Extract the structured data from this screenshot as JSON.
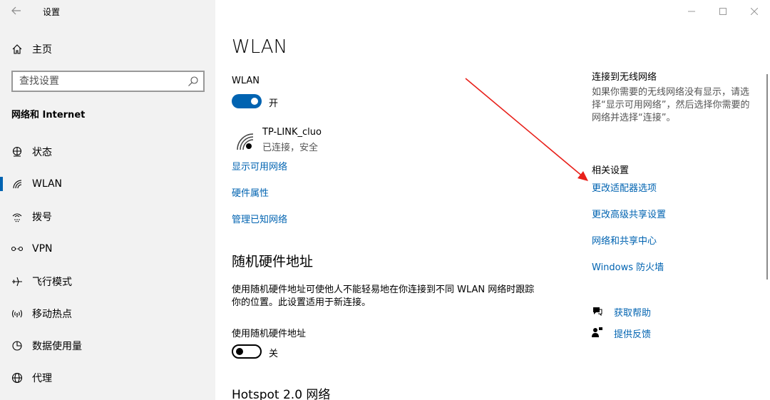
{
  "titlebar": {
    "title": "设置",
    "back_icon": "arrow-left-icon",
    "controls": [
      "minimize-icon",
      "maximize-icon",
      "close-icon"
    ]
  },
  "sidebar": {
    "home_label": "主页",
    "search_placeholder": "查找设置",
    "section": "网络和 Internet",
    "items": [
      {
        "label": "状态",
        "icon": "globe-status-icon"
      },
      {
        "label": "WLAN",
        "icon": "wifi-icon",
        "selected": true
      },
      {
        "label": "拨号",
        "icon": "dialup-icon"
      },
      {
        "label": "VPN",
        "icon": "vpn-icon"
      },
      {
        "label": "飞行模式",
        "icon": "airplane-icon"
      },
      {
        "label": "移动热点",
        "icon": "hotspot-icon"
      },
      {
        "label": "数据使用量",
        "icon": "data-usage-icon"
      },
      {
        "label": "代理",
        "icon": "globe-icon"
      }
    ]
  },
  "main": {
    "title": "WLAN",
    "wlan_label": "WLAN",
    "wlan_toggle": {
      "state": "on",
      "text": "开"
    },
    "network": {
      "name": "TP-LINK_cluo",
      "status": "已连接，安全"
    },
    "links": [
      "显示可用网络",
      "硬件属性",
      "管理已知网络"
    ],
    "random_mac": {
      "title": "随机硬件地址",
      "description": "使用随机硬件地址可使他人不能轻易地在你连接到不同 WLAN 网络时跟踪你的位置。此设置适用于新连接。",
      "toggle_label": "使用随机硬件地址",
      "toggle": {
        "state": "off",
        "text": "关"
      }
    },
    "hotspot_title": "Hotspot 2.0 网络"
  },
  "right": {
    "connect_title": "连接到无线网络",
    "connect_desc": "如果你需要的无线网络没有显示，请选择“显示可用网络”，然后选择你需要的网络并选择“连接”。",
    "related_title": "相关设置",
    "related_links": [
      "更改适配器选项",
      "更改高级共享设置",
      "网络和共享中心",
      "Windows 防火墙"
    ],
    "help": {
      "get_help": "获取帮助",
      "feedback": "提供反馈"
    }
  },
  "colors": {
    "accent": "#0063b1",
    "sidebar_bg": "#f2f2f2",
    "annotation_arrow": "#e8201a"
  }
}
